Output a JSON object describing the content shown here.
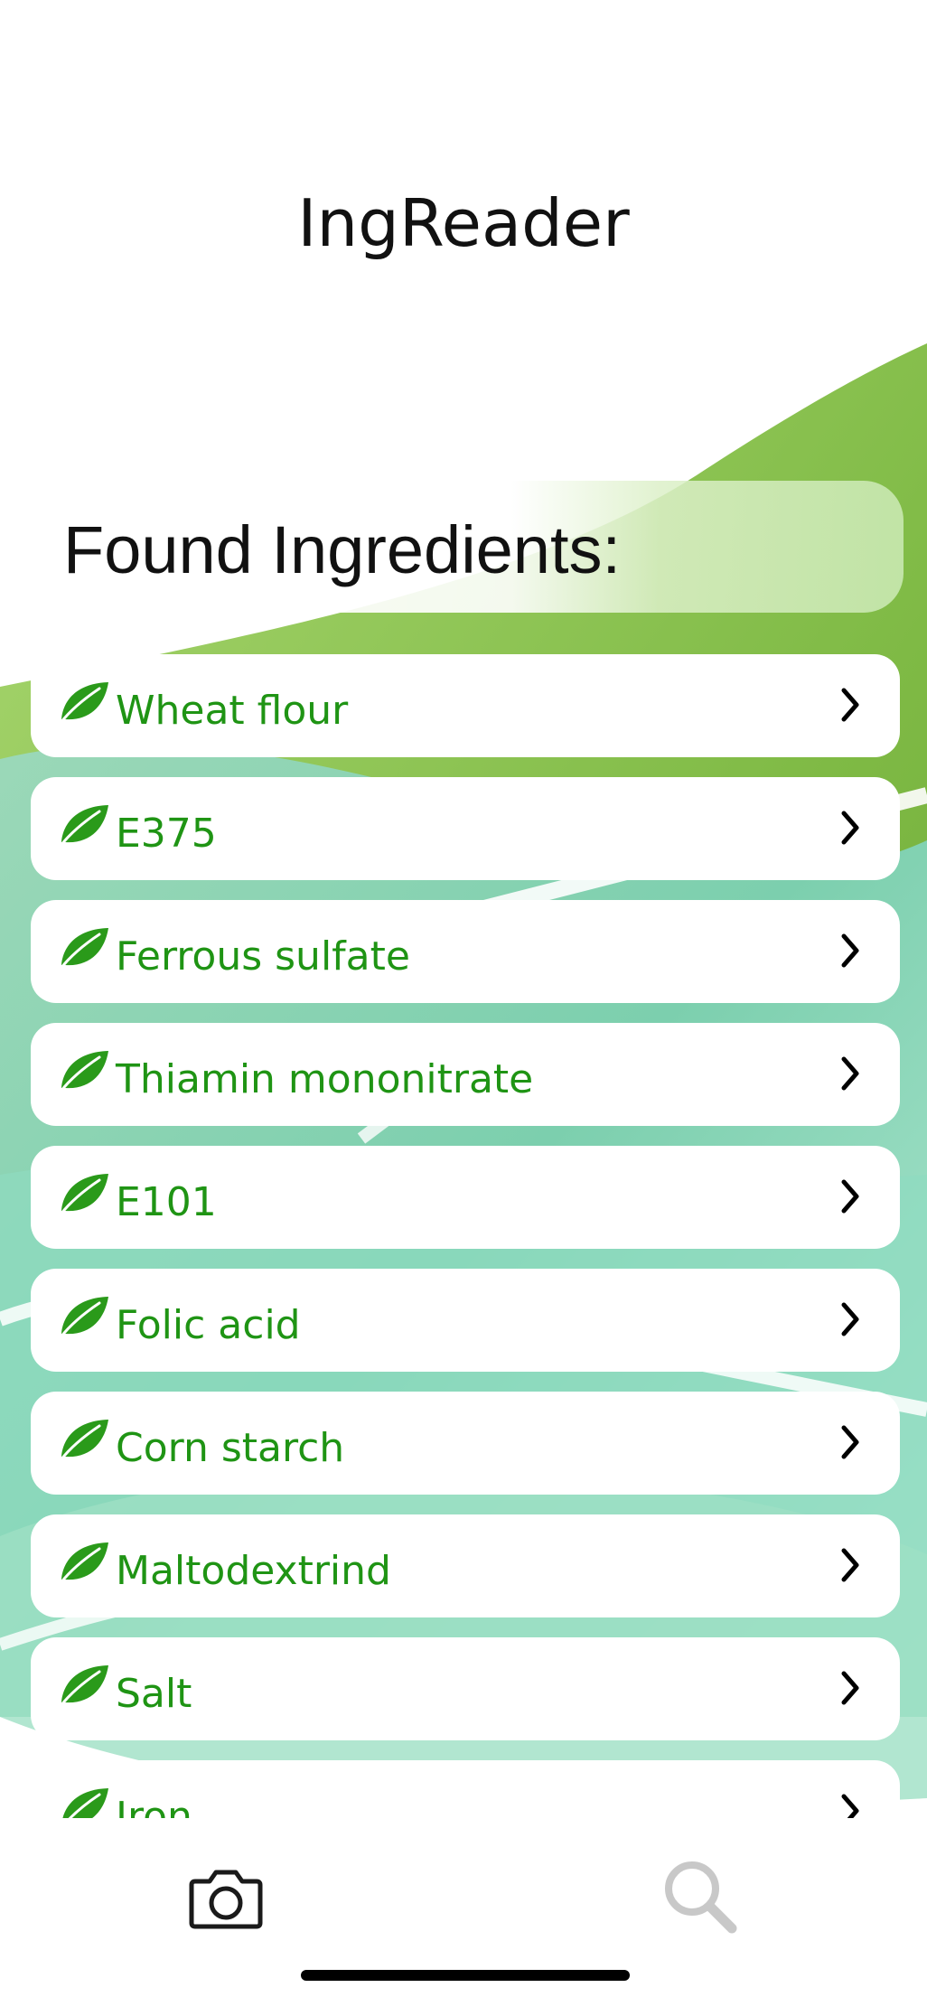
{
  "app": {
    "title": "IngReader"
  },
  "list": {
    "header": "Found Ingredients:",
    "items": [
      {
        "name": "Wheat flour",
        "icon": "leaf-icon"
      },
      {
        "name": "E375",
        "icon": "leaf-icon"
      },
      {
        "name": "Ferrous sulfate",
        "icon": "leaf-icon"
      },
      {
        "name": "Thiamin mononitrate",
        "icon": "leaf-icon"
      },
      {
        "name": "E101",
        "icon": "leaf-icon"
      },
      {
        "name": "Folic acid",
        "icon": "leaf-icon"
      },
      {
        "name": "Corn starch",
        "icon": "leaf-icon"
      },
      {
        "name": "Maltodextrind",
        "icon": "leaf-icon"
      },
      {
        "name": "Salt",
        "icon": "leaf-icon"
      },
      {
        "name": "Iron",
        "icon": "leaf-icon"
      }
    ]
  },
  "tabbar": {
    "tabs": [
      {
        "name": "camera",
        "icon": "camera-icon",
        "active": true
      },
      {
        "name": "search",
        "icon": "search-icon",
        "active": false
      }
    ]
  },
  "colors": {
    "accent": "#1f9414",
    "leaf": "#2a9a1a",
    "background_green": "#8cc152",
    "background_teal": "#7fd4b4",
    "inactive_icon": "#c8c8c8"
  }
}
